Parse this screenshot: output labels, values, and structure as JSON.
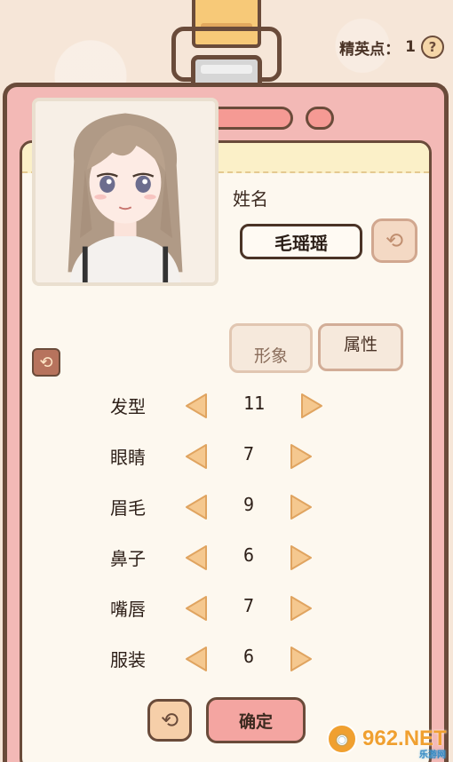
{
  "header": {
    "elite_points_label": "精英点：",
    "elite_points_value": "1",
    "help_label": "?"
  },
  "profile": {
    "name_label": "姓名",
    "name_value": "毛瑶瑶",
    "tabs": [
      "形象",
      "属性"
    ],
    "selected_tab": "形象"
  },
  "features": [
    {
      "label": "发型",
      "value": "11"
    },
    {
      "label": "眼睛",
      "value": "7"
    },
    {
      "label": "眉毛",
      "value": "9"
    },
    {
      "label": "鼻子",
      "value": "6"
    },
    {
      "label": "嘴唇",
      "value": "7"
    },
    {
      "label": "服装",
      "value": "6"
    }
  ],
  "footer": {
    "confirm_label": "确定"
  },
  "watermark": {
    "brand": "962.NET",
    "sub": "乐游网"
  },
  "colors": {
    "card_pink": "#f3b9b6",
    "outline_brown": "#6a4b3a",
    "arrow_fill": "#f5c88f",
    "confirm_pink": "#f4a5a1"
  }
}
